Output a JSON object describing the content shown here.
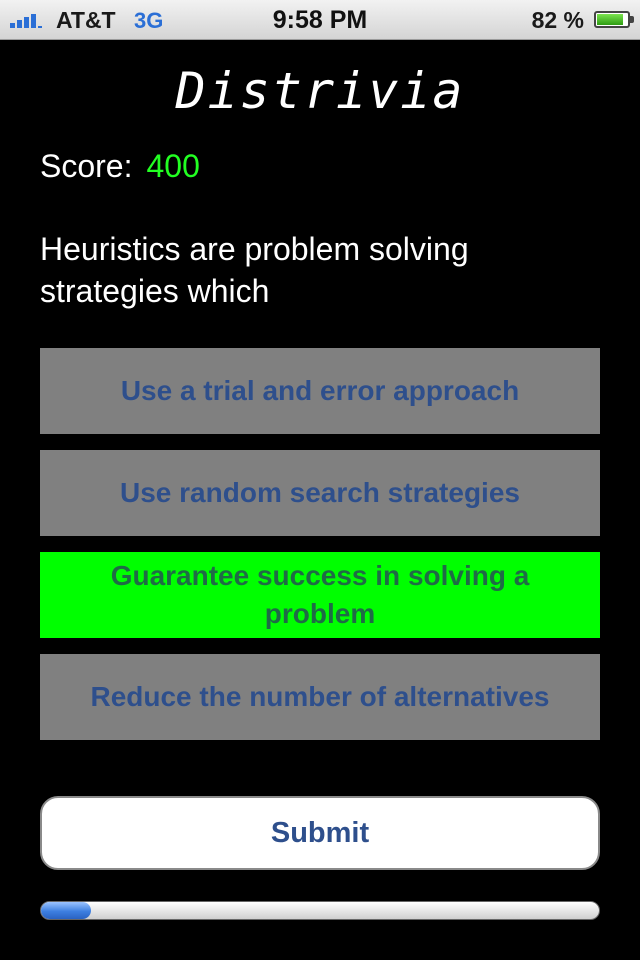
{
  "status_bar": {
    "carrier": "AT&T",
    "network": "3G",
    "time": "9:58 PM",
    "battery_percent": "82 %",
    "battery_level": 0.82,
    "signal_bars": 4
  },
  "app": {
    "title": "Distrivia"
  },
  "score": {
    "label": "Score:",
    "value": "400"
  },
  "question": {
    "text": "Heuristics are problem solving strategies which"
  },
  "answers": [
    {
      "label": "Use a trial and error approach",
      "selected": false
    },
    {
      "label": "Use random search strategies",
      "selected": false
    },
    {
      "label": "Guarantee success in solving a problem",
      "selected": true
    },
    {
      "label": "Reduce the number of alternatives",
      "selected": false
    }
  ],
  "submit": {
    "label": "Submit"
  },
  "progress": {
    "fraction": 0.09
  },
  "colors": {
    "background": "#000000",
    "score_value": "#22ff22",
    "answer_bg": "#808080",
    "answer_selected_bg": "#00ff00",
    "answer_text": "#2e4f8c",
    "selected_text": "#1f6b46"
  }
}
